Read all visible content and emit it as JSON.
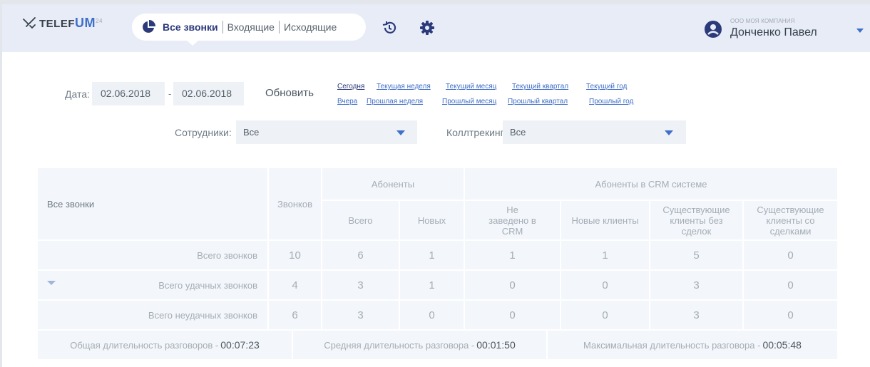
{
  "app": {
    "logo_text": "TELEFUM",
    "logo_tail": "UM",
    "logo_sup": "24"
  },
  "header": {
    "tabs": [
      {
        "label": "Все звонки",
        "active": true
      },
      {
        "label": "Входящие",
        "active": false
      },
      {
        "label": "Исходящие",
        "active": false
      }
    ],
    "company": "ООО МОЯ КОМПАНИЯ",
    "user": "Донченко Павел",
    "accent": "#3f6fc8"
  },
  "filters": {
    "date_label": "Дата:",
    "date_from": "02.06.2018",
    "date_sep": "-",
    "date_to": "02.06.2018",
    "refresh": "Обновить",
    "quick_row1": [
      "Сегодня",
      "Текущая неделя",
      "Текущий месяц",
      "Текущий квартал",
      "Текущий год"
    ],
    "quick_row2": [
      "Вчера",
      "Прошлая неделя",
      "Прошлый месяц",
      "Прошлый квартал",
      "Прошлый год"
    ],
    "employees_label": "Сотрудники:",
    "employees_value": "Все",
    "calltracking_label": "Коллтрекинг:",
    "calltracking_value": "Все"
  },
  "table": {
    "corner": "Все звонки",
    "calls": "Звонков",
    "subscribers": "Абоненты",
    "crm_group": "Абоненты в CRM системе",
    "sub_cols": [
      "Всего",
      "Новых"
    ],
    "crm_cols": [
      "Не заведено в CRM",
      "Новые клиенты",
      "Существующие клиенты без сделок",
      "Существующие клиенты со сделками"
    ],
    "rows": [
      {
        "label": "Всего звонков",
        "values": [
          "10",
          "6",
          "1",
          "1",
          "1",
          "5",
          "0"
        ]
      },
      {
        "label": "Всего удачных звонков",
        "values": [
          "4",
          "3",
          "1",
          "0",
          "0",
          "3",
          "0"
        ]
      },
      {
        "label": "Всего неудачных звонков",
        "values": [
          "6",
          "3",
          "0",
          "0",
          "0",
          "3",
          "0"
        ]
      }
    ],
    "footer": [
      {
        "label": "Общая длительность разговоров -",
        "value": "00:07:23"
      },
      {
        "label": "Средняя длительность разговора -",
        "value": "00:01:50"
      },
      {
        "label": "Максимальная длительность разговора -",
        "value": "00:05:48"
      }
    ]
  }
}
